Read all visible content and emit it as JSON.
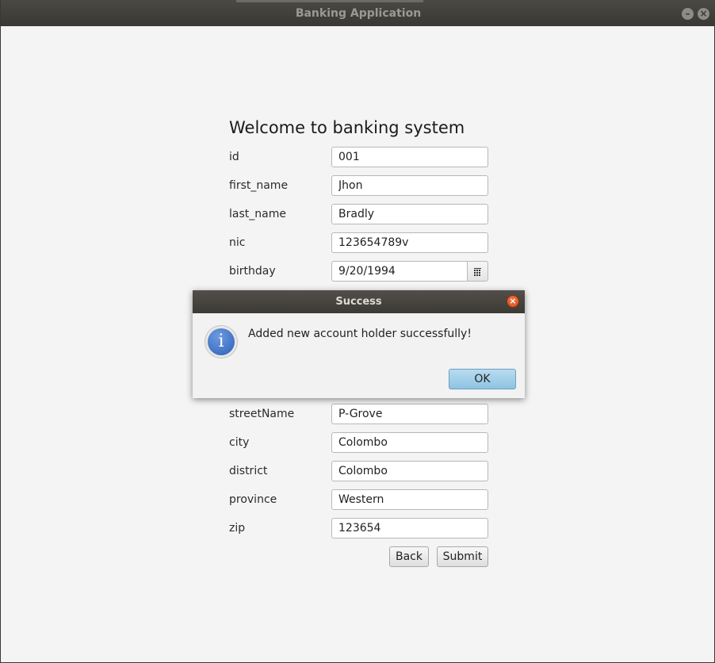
{
  "window": {
    "title": "Banking Application"
  },
  "form": {
    "title": "Welcome to banking system",
    "fields": [
      {
        "label": "id",
        "value": "001"
      },
      {
        "label": "first_name",
        "value": "Jhon"
      },
      {
        "label": "last_name",
        "value": "Bradly"
      },
      {
        "label": "nic",
        "value": "123654789v"
      },
      {
        "label": "birthday",
        "value": "9/20/1994"
      },
      {
        "label": "streetName",
        "value": "P-Grove"
      },
      {
        "label": "city",
        "value": "Colombo"
      },
      {
        "label": "district",
        "value": "Colombo"
      },
      {
        "label": "province",
        "value": "Western"
      },
      {
        "label": "zip",
        "value": "123654"
      }
    ],
    "back_label": "Back",
    "submit_label": "Submit"
  },
  "dialog": {
    "title": "Success",
    "message": "Added new account holder successfully!",
    "ok_label": "OK",
    "icon": "info-icon"
  },
  "colors": {
    "titlebar": "#3a3833",
    "ok_button": "#8ec3e3",
    "info_icon": "#2e5fb8",
    "close_button": "#d84a1b"
  }
}
